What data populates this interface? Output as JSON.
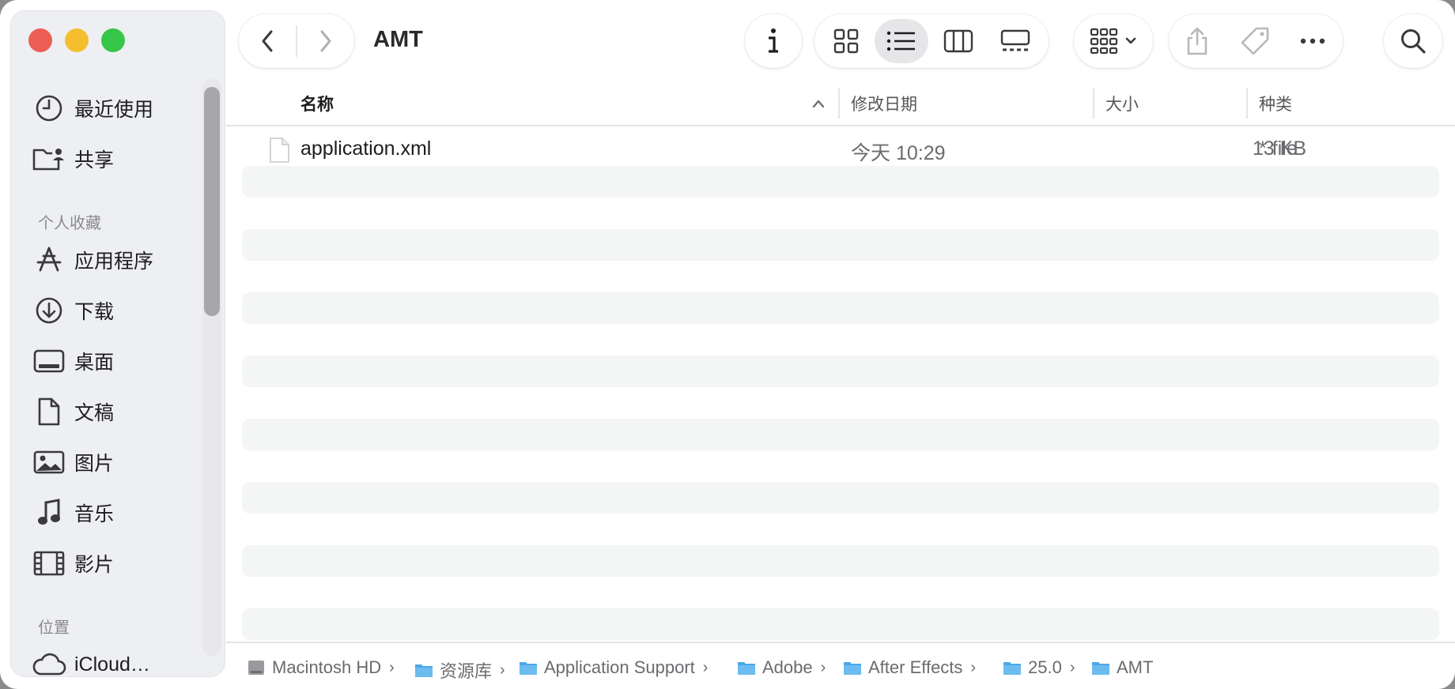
{
  "window": {
    "title": "AMT"
  },
  "sidebar": {
    "favorites_items": [
      {
        "label": "最近使用",
        "icon": "clock-icon"
      },
      {
        "label": "共享",
        "icon": "shared-folder-icon"
      }
    ],
    "section_personal": "个人收藏",
    "personal_items": [
      {
        "label": "应用程序",
        "icon": "applications-icon"
      },
      {
        "label": "下载",
        "icon": "download-icon"
      },
      {
        "label": "桌面",
        "icon": "desktop-icon"
      },
      {
        "label": "文稿",
        "icon": "document-icon"
      },
      {
        "label": "图片",
        "icon": "photo-icon"
      },
      {
        "label": "音乐",
        "icon": "music-icon"
      },
      {
        "label": "影片",
        "icon": "film-icon"
      }
    ],
    "section_locations": "位置",
    "location_items": [
      {
        "label": "iCloud…",
        "icon": "cloud-icon"
      }
    ]
  },
  "columns": {
    "name": "名称",
    "date": "修改日期",
    "size": "大小",
    "kind": "种类"
  },
  "files": [
    {
      "name": "application.xml",
      "date": "今天 10:29",
      "size": "13 KB",
      "kind": "* file"
    }
  ],
  "pathbar": [
    {
      "label": "Macintosh HD",
      "icon": "disk-icon"
    },
    {
      "label": "资源库",
      "icon": "folder-icon"
    },
    {
      "label": "Application Support",
      "icon": "folder-icon"
    },
    {
      "label": "Adobe",
      "icon": "folder-icon"
    },
    {
      "label": "After Effects",
      "icon": "folder-icon"
    },
    {
      "label": "25.0",
      "icon": "folder-icon"
    },
    {
      "label": "AMT",
      "icon": "folder-icon"
    }
  ],
  "colors": {
    "folder_blue": "#4ba8e8",
    "accent_selected": "#e6e6e8"
  }
}
